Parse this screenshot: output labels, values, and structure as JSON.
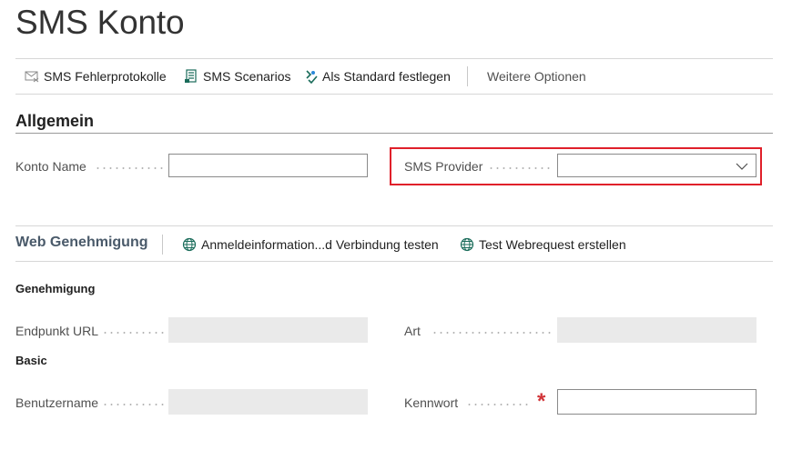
{
  "page": {
    "title": "SMS Konto"
  },
  "toolbar": {
    "error_log": "SMS Fehlerprotokolle",
    "scenarios": "SMS Scenarios",
    "set_default": "Als Standard festlegen",
    "more_options": "Weitere Optionen"
  },
  "general": {
    "title": "Allgemein",
    "account_name_label": "Konto Name",
    "account_name_value": "",
    "sms_provider_label": "SMS Provider",
    "sms_provider_value": ""
  },
  "web_auth": {
    "title": "Web Genehmigung",
    "test_credentials": "Anmeldeinformation...d Verbindung testen",
    "create_test_request": "Test Webrequest erstellen",
    "group_title": "Genehmigung",
    "endpoint_label": "Endpunkt URL",
    "endpoint_value": "",
    "type_label": "Art",
    "type_value": "",
    "basic_title": "Basic",
    "username_label": "Benutzername",
    "username_value": "",
    "password_label": "Kennwort",
    "password_value": "",
    "required_marker": "*"
  },
  "colors": {
    "highlight": "#e0202a",
    "required": "#d13438",
    "readonly_field": "#eaeaea"
  },
  "icons": {
    "error_log": "envelope-error-icon",
    "scenarios": "document-list-icon",
    "set_default": "default-check-icon",
    "test_credentials": "globe-icon",
    "create_test_request": "globe-icon",
    "dropdown": "chevron-down-icon"
  }
}
